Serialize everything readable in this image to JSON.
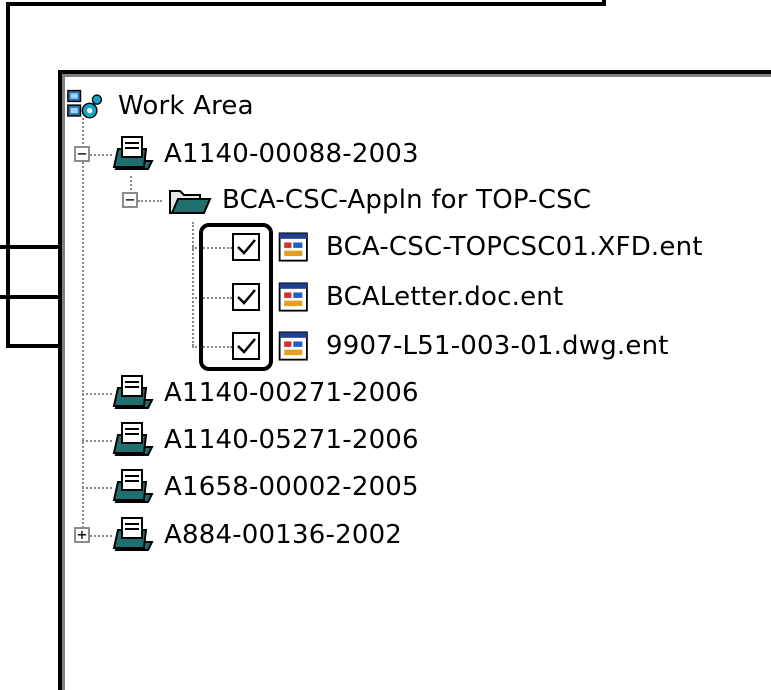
{
  "tree": {
    "root": {
      "label": "Work Area",
      "icon": "work-area-network-icon"
    },
    "items": [
      {
        "label": "A1140-00088-2003",
        "icon": "file-cabinet-icon",
        "expander": "−"
      },
      {
        "label": "BCA-CSC-Appln for TOP-CSC",
        "icon": "open-folder-icon",
        "expander": "−"
      },
      {
        "label": "BCA-CSC-TOPCSC01.XFD.ent",
        "icon": "document-window-icon",
        "checked": true
      },
      {
        "label": "BCALetter.doc.ent",
        "icon": "document-window-icon",
        "checked": true
      },
      {
        "label": "9907-L51-003-01.dwg.ent",
        "icon": "document-window-icon",
        "checked": true
      },
      {
        "label": "A1140-00271-2006",
        "icon": "file-cabinet-icon"
      },
      {
        "label": "A1140-05271-2006",
        "icon": "file-cabinet-icon"
      },
      {
        "label": "A1658-00002-2005",
        "icon": "file-cabinet-icon"
      },
      {
        "label": "A884-00136-2002",
        "icon": "file-cabinet-icon",
        "expander": "+"
      }
    ]
  },
  "colors": {
    "accent_teal": "#1f6f6f",
    "tree_line": "#8a8a8a"
  }
}
